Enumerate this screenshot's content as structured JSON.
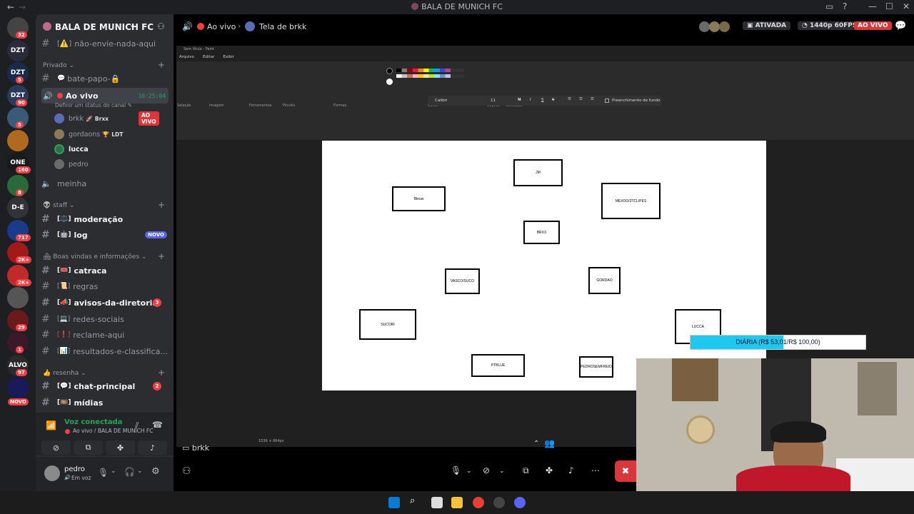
{
  "titlebar": {
    "title": "BALA DE MUNICH FC"
  },
  "rail": {
    "servers": [
      {
        "label": "",
        "badge": "32"
      },
      {
        "label": "DZT",
        "badge": ""
      },
      {
        "label": "DZT",
        "badge": "5"
      },
      {
        "label": "DZT",
        "badge": "90"
      },
      {
        "label": "",
        "badge": "5"
      },
      {
        "label": "",
        "badge": ""
      },
      {
        "label": "ONE",
        "badge": "160"
      },
      {
        "label": "",
        "badge": "8"
      },
      {
        "label": "D-E",
        "badge": ""
      },
      {
        "label": "",
        "badge": "717"
      },
      {
        "label": "",
        "badge": "2K+"
      },
      {
        "label": "",
        "badge": "2K+"
      },
      {
        "label": "",
        "badge": ""
      },
      {
        "label": "",
        "badge": "29"
      },
      {
        "label": "",
        "badge": "1"
      },
      {
        "label": "ALVO",
        "badge": "97"
      },
      {
        "label": "",
        "badge": ""
      }
    ],
    "new_label": "NOVO"
  },
  "sidebar": {
    "server_name": "BALA DE MUNICH FC",
    "top_channel": "não-envie-nada-aqui",
    "private_category": "Privado",
    "private_channel": "bate-papo-🔒",
    "live_channel": "Ao vivo",
    "live_time": "10:25:04",
    "status_prompt": "Definir um status do canal",
    "users": [
      {
        "name": "brkk",
        "tag": "Brxx",
        "badge": "AO VIVO"
      },
      {
        "name": "gordaons",
        "tag": "LDT",
        "badge": ""
      },
      {
        "name": "lucca",
        "tag": "",
        "badge": ""
      },
      {
        "name": "pedro",
        "tag": "",
        "badge": ""
      }
    ],
    "voice_channel_2": "meinha",
    "staff_category": "staff",
    "moderacao": "moderação",
    "log": "log",
    "log_badge": "NOVO",
    "boas_vindas_category": "Boas vindas e informações",
    "catraca": "catraca",
    "regras": "regras",
    "avisos": "avisos-da-diretoria",
    "avisos_count": "3",
    "redes": "redes-sociais",
    "reclame": "reclame-aqui",
    "resultados": "resultados-e-classifica...",
    "resenha_category": "resenha",
    "chat_principal": "chat-principal",
    "chat_count": "2",
    "midias": "mídias"
  },
  "voice_panel": {
    "status": "Voz conectada",
    "location": "Ao vivo / BALA DE MUNICH FC"
  },
  "user_panel": {
    "name": "pedro",
    "status": "Em voz"
  },
  "topbar": {
    "channel": "Ao vivo",
    "screen": "Tela de brkk",
    "activated": "ATIVADA",
    "quality": "1440p 60FPS",
    "live": "AO VIVO"
  },
  "paint": {
    "title": "Sem título - Paint",
    "menu": [
      "Arquivo",
      "Editar",
      "Exibir"
    ],
    "groups": [
      "Seleção",
      "Imagem",
      "Ferramentas",
      "Pincéis",
      "Formas",
      "Cores",
      "Copilot",
      "Camadas"
    ],
    "font": "Calibri",
    "font_size": "11",
    "fill_label": "Preenchimento de fundo",
    "status_size": "1536 × 864px"
  },
  "canvas_boxes": [
    {
      "label": "JM"
    },
    {
      "label": "Bleuw"
    },
    {
      "label": "MEXOO/2TCLIPES"
    },
    {
      "label": "BRXX"
    },
    {
      "label": "VASCO/SUCO"
    },
    {
      "label": "GORDAO"
    },
    {
      "label": "SUCORI"
    },
    {
      "label": "LUCCA"
    },
    {
      "label": "PTBLUE"
    },
    {
      "label": "PEDROSEMFREIO"
    }
  ],
  "donation": {
    "text": "DIÁRIA (R$ 53,01/R$ 100,00)",
    "progress": 0.53
  },
  "stream_footer": {
    "viewer": "brkk"
  },
  "colors": {
    "live_red": "#da373c",
    "progress_cyan": "#1ec8ee",
    "discord_bg": "#2b2d31"
  }
}
